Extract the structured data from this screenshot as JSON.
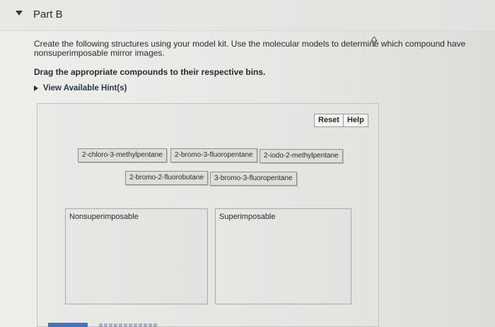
{
  "part": {
    "title": "Part B"
  },
  "instructions": {
    "text": "Create the following structures using your model kit. Use the molecular models to determine which compound have nonsuperimposable mirror images.",
    "drag": "Drag the appropriate compounds to their respective bins."
  },
  "hint": {
    "label": "View Available Hint(s)"
  },
  "toolbar": {
    "reset_label": "Reset",
    "help_label": "Help"
  },
  "compounds": [
    "2-chloro-3-methylpentane",
    "2-bromo-3-fluoropentane",
    "2-iodo-2-methylpentane",
    "2-bromo-2-fluorobutane",
    "3-bromo-3-fluoropentane"
  ],
  "bins": [
    {
      "label": "Nonsuperimposable"
    },
    {
      "label": "Superimposable"
    }
  ],
  "icons": {
    "collapse": "triangle-down-icon",
    "hint": "play-icon",
    "cursor": "pointer-cursor-icon"
  },
  "colors": {
    "submit": "#3f78b8",
    "chip_border": "#8f8f8b"
  }
}
